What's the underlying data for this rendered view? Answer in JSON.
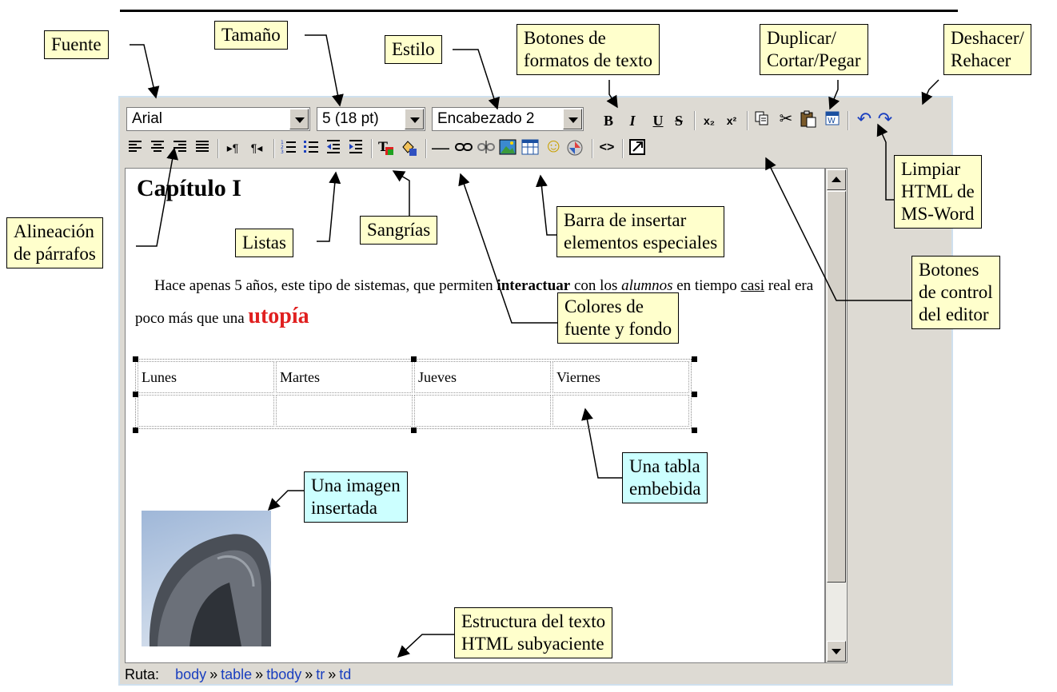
{
  "toolbar": {
    "font": "Arial",
    "size": "5 (18 pt)",
    "style": "Encabezado 2"
  },
  "document": {
    "heading": "Capítulo I",
    "para_start": "Hace apenas 5 años, este tipo de sistemas, que permiten ",
    "para_bold": "interactuar",
    "para_mid1": " con los ",
    "para_italic": "alumnos",
    "para_mid2": " en tiempo ",
    "para_underline": "casi",
    "para_mid3": " real era poco más que una ",
    "para_big": "utopía",
    "table_headers": [
      "Lunes",
      "Martes",
      "Jueves",
      "Viernes"
    ]
  },
  "statusbar": {
    "label": "Ruta:",
    "path": [
      "body",
      "table",
      "tbody",
      "tr",
      "td"
    ],
    "sep": "»"
  },
  "callouts": {
    "fuente": "Fuente",
    "tamano": "Tamaño",
    "estilo": "Estilo",
    "botones_formato": [
      "Botones de",
      "formatos de texto"
    ],
    "duplicar": [
      "Duplicar/",
      "Cortar/Pegar"
    ],
    "deshacer": [
      "Deshacer/",
      "Rehacer"
    ],
    "limpiar": [
      "Limpiar",
      "HTML de",
      "MS-Word"
    ],
    "alineacion": [
      "Alineación",
      "de párrafos"
    ],
    "listas": "Listas",
    "sangrias": "Sangrías",
    "barra_insertar": [
      "Barra de insertar",
      "elementos especiales"
    ],
    "botones_control": [
      "Botones",
      "de control",
      "del editor"
    ],
    "colores": [
      "Colores de",
      "fuente y fondo"
    ],
    "tabla": [
      "Una tabla",
      "embebida"
    ],
    "imagen": [
      "Una imagen",
      "insertada"
    ],
    "estructura": [
      "Estructura del texto",
      "HTML subyaciente"
    ]
  },
  "colors": {
    "callout_yellow": "#ffffcc",
    "callout_cyan": "#ccffff",
    "editor_bg": "#dddad3",
    "link_blue": "#1a3fbf",
    "emphasis_red": "#e02020"
  },
  "icons": {
    "bold": "B",
    "italic": "I",
    "underline": "U",
    "strike": "S",
    "subscript": "x₂",
    "superscript": "x²",
    "copy": "copy-icon",
    "cut": "✂",
    "paste": "paste-icon",
    "word": "word-icon",
    "undo": "↶",
    "redo": "↷",
    "ltr": "▸¶",
    "rtl": "¶◂",
    "source": "<>",
    "fullscreen": "fullscreen-icon",
    "hr": "—",
    "smiley": "☺"
  }
}
